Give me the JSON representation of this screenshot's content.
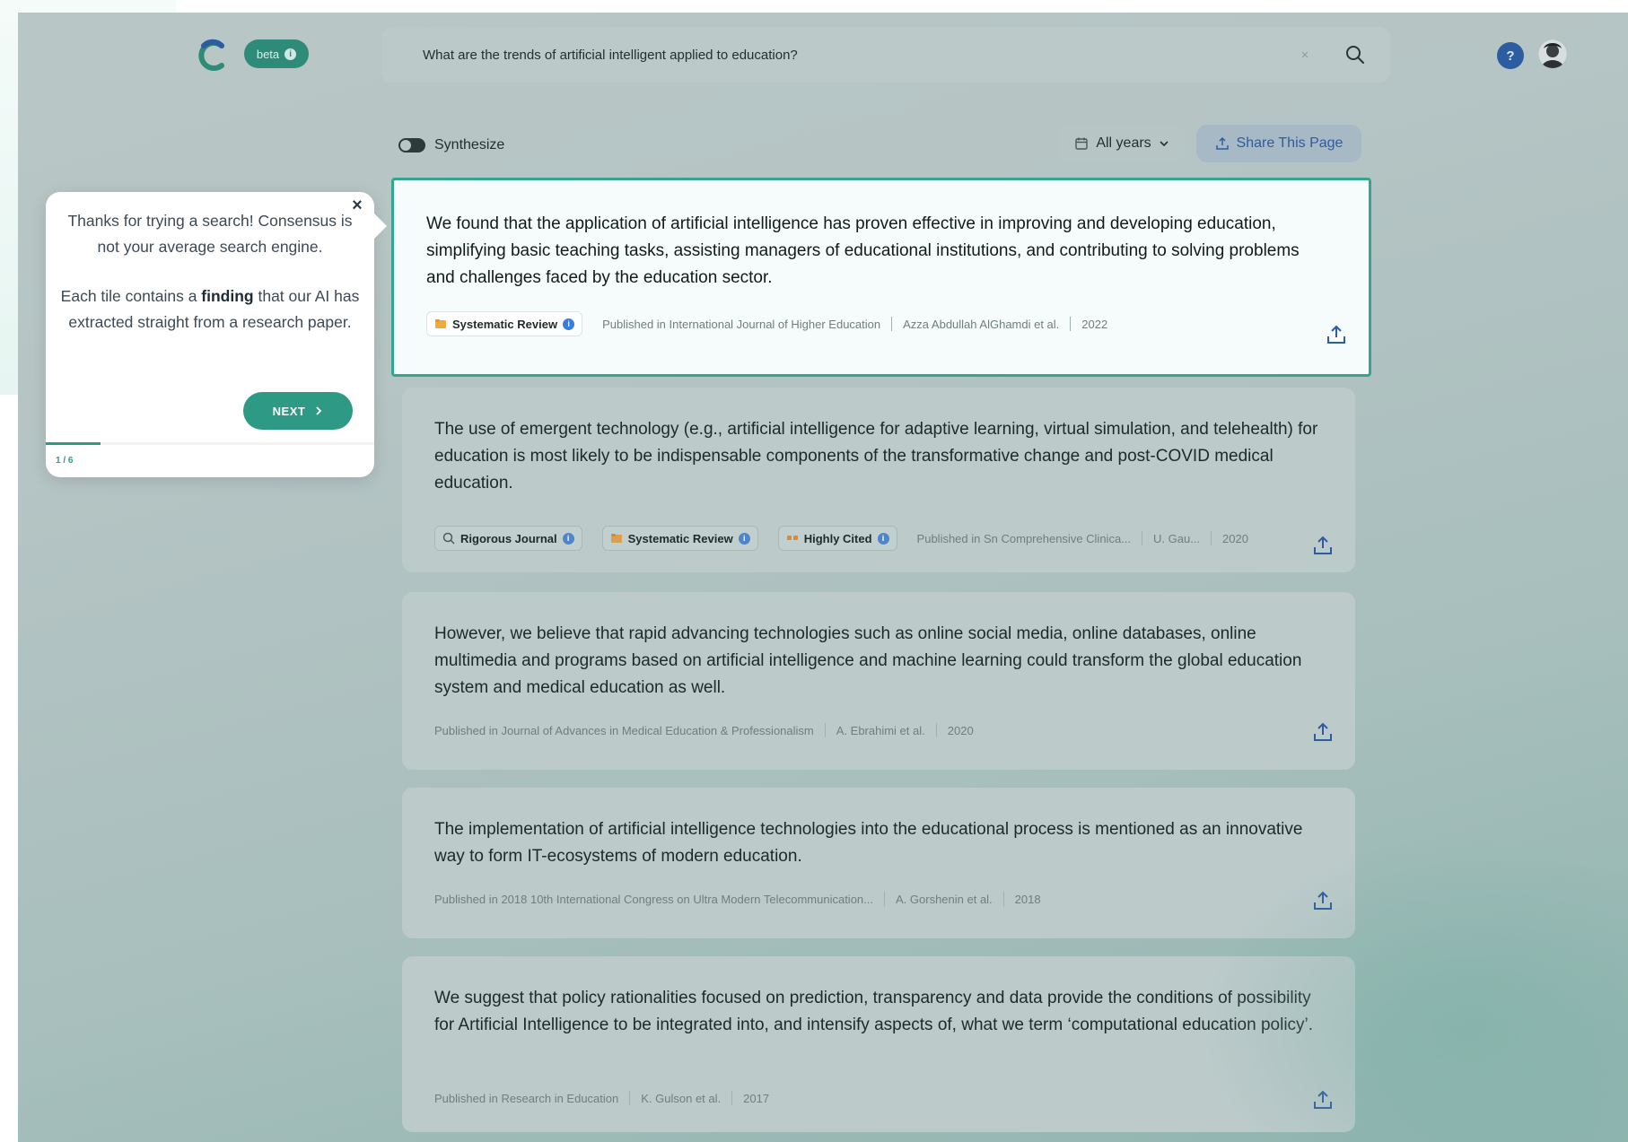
{
  "app": {
    "beta_label": "beta",
    "beta_info": "i",
    "colors": {
      "brand": "#2e9a86",
      "accent_blue": "#2b5da0",
      "card_border": "#35a68d"
    }
  },
  "search": {
    "query": "What are the trends of artificial intelligent applied to education?",
    "clear_glyph": "×"
  },
  "header": {
    "help_glyph": "?"
  },
  "toolbar": {
    "synthesize_label": "Synthesize",
    "synthesize_on": false,
    "years_label": "All years",
    "share_page_label": "Share This Page"
  },
  "results": [
    {
      "finding": "We found that the application of artificial intelligence has proven effective in improving and developing education, simplifying basic teaching tasks, assisting managers of educational institutions, and contributing to solving problems and challenges faced by the education sector.",
      "badges": [
        "Systematic Review"
      ],
      "journal": "Published in International Journal of Higher Education",
      "authors": "Azza Abdullah AlGhamdi et al.",
      "year": "2022"
    },
    {
      "finding": "The use of emergent technology (e.g., artificial intelligence for adaptive learning, virtual simulation, and telehealth) for education is most likely to be indispensable components of the transformative change and post-COVID medical education.",
      "badges": [
        "Rigorous Journal",
        "Systematic Review",
        "Highly Cited"
      ],
      "journal": "Published in Sn Comprehensive Clinica...",
      "authors": "U. Gau...",
      "year": "2020"
    },
    {
      "finding": "However, we believe that rapid advancing technologies such as online social media, online databases, online multimedia and programs based on artificial intelligence and machine learning could transform the global education system and medical education as well.",
      "journal": "Published in Journal of Advances in Medical Education & Professionalism",
      "authors": "A. Ebrahimi et al.",
      "year": "2020"
    },
    {
      "finding": "The implementation of artificial intelligence technologies into the educational process is mentioned as an innovative way to form IT-ecosystems of modern education.",
      "journal": "Published in 2018 10th International Congress on Ultra Modern Telecommunication...",
      "authors": "A. Gorshenin et al.",
      "year": "2018"
    },
    {
      "finding": "We suggest that policy rationalities focused on prediction, transparency and data provide the conditions of possibility for Artificial Intelligence to be integrated into, and intensify aspects of, what we term ‘computational education policy’.",
      "journal": "Published in Research in Education",
      "authors": "K. Gulson et al.",
      "year": "2017"
    }
  ],
  "tour": {
    "line1": "Thanks for trying a search! Consensus is not your average search engine.",
    "line2_pre": "Each tile contains a ",
    "line2_bold": "finding",
    "line2_post": " that our AI has extracted straight from a research paper.",
    "next_label": "NEXT",
    "close_glyph": "×",
    "step": "1 / 6",
    "progress": 0.1667
  }
}
